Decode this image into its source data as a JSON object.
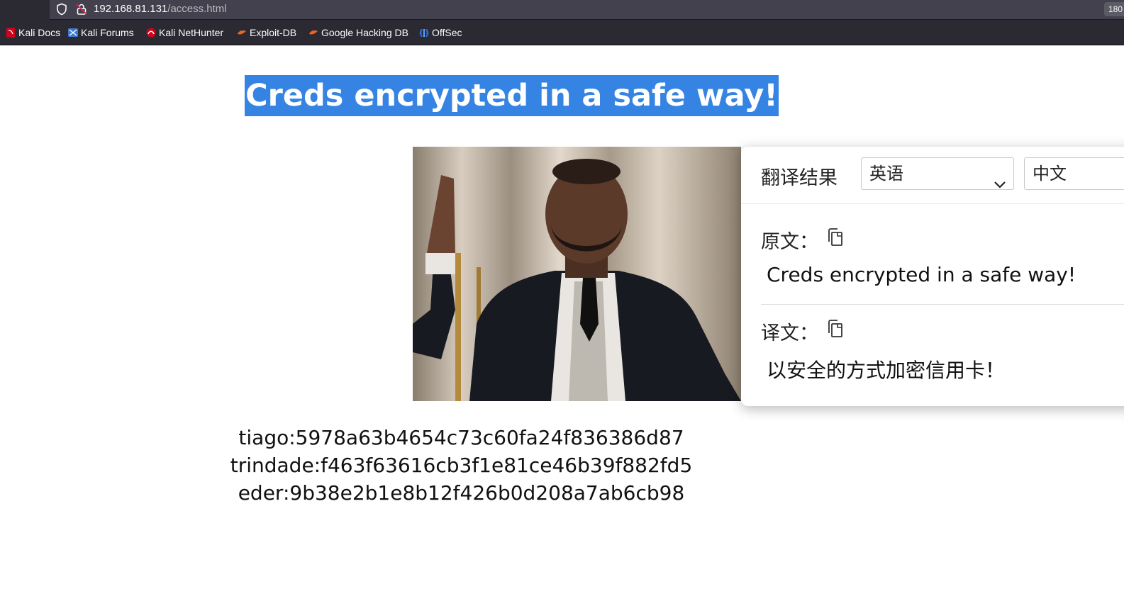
{
  "browser": {
    "url_host": "192.168.81.131",
    "url_path": "/access.html",
    "zoom_badge": "180",
    "bookmarks": [
      {
        "label": "Kali Docs",
        "icon": "kali-docs-icon"
      },
      {
        "label": "Kali Forums",
        "icon": "kali-forums-icon"
      },
      {
        "label": "Kali NetHunter",
        "icon": "kali-nethunter-icon"
      },
      {
        "label": "Exploit-DB",
        "icon": "exploit-db-icon"
      },
      {
        "label": "Google Hacking DB",
        "icon": "google-hacking-db-icon"
      },
      {
        "label": "OffSec",
        "icon": "offsec-icon"
      }
    ]
  },
  "page": {
    "title": "Creds encrypted in a safe way!",
    "title_highlight_color": "#3584e4",
    "credentials": [
      "tiago:5978a63b4654c73c60fa24f836386d87",
      "trindade:f463f63616cb3f1e81ce46b39f882fd5",
      "eder:9b38e2b1e8b12f426b0d208a7ab6cb98"
    ]
  },
  "translate_popup": {
    "title": "翻译结果",
    "source_lang": "英语",
    "target_lang": "中文",
    "original_label": "原文：",
    "original_text": "Creds encrypted in a safe way!",
    "translation_label": "译文：",
    "translation_text": "以安全的方式加密信用卡！"
  }
}
